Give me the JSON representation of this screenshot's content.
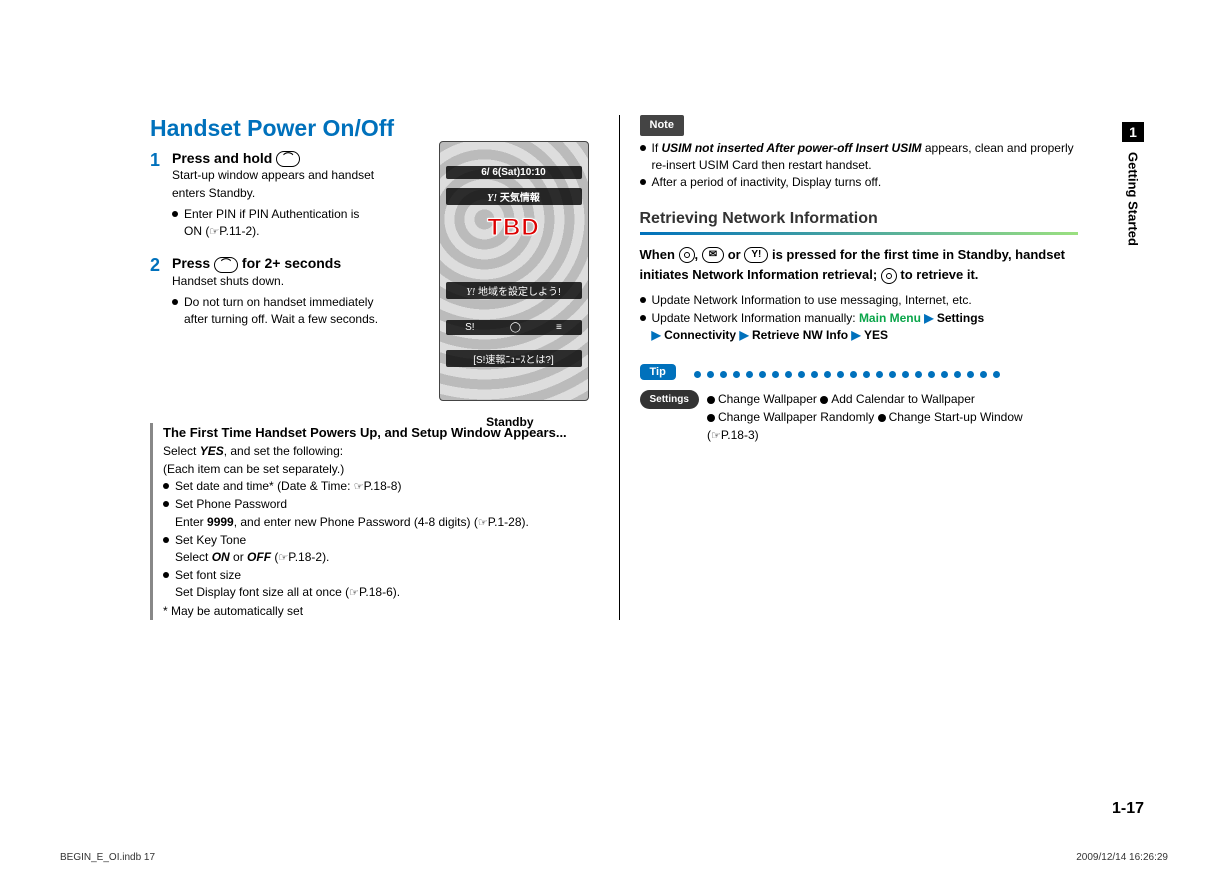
{
  "chapter_tab": {
    "num": "1",
    "label": "Getting Started"
  },
  "title": "Handset Power On/Off",
  "steps": {
    "s1": {
      "num": "1",
      "head_prefix": "Press and hold ",
      "key_glyph": "⏻",
      "body": "Start-up window appears and handset enters Standby.",
      "bullet": "Enter PIN if PIN Authentication is ON (",
      "ref": "P.11-2",
      "bullet_suffix": ")."
    },
    "s2": {
      "num": "2",
      "head_prefix": "Press ",
      "key_glyph": "⏻",
      "head_suffix": " for 2+ seconds",
      "body": "Handset shuts down.",
      "bullet": "Do not turn on handset immediately after turning off. Wait a few seconds."
    }
  },
  "screenshot": {
    "time": "6/  6(Sat)10:10",
    "weather": "天気情報",
    "tbd": "TBD",
    "region": "地域を設定しよう!",
    "news": "[S!速報ﾆｭｰｽとは?]",
    "caption": "Standby"
  },
  "first_time": {
    "head": "The First Time Handset Powers Up, and Setup Window Appears...",
    "select_prefix": "Select ",
    "yes": "YES",
    "select_suffix": ", and set the following:",
    "each": "(Each item can be set separately.)",
    "items": {
      "i1": {
        "text": "Set date and time* (Date & Time: ",
        "ref": "P.18-8",
        "suffix": ")"
      },
      "i2": {
        "text": "Set Phone Password",
        "sub_prefix": "Enter ",
        "code": "9999",
        "sub_mid": ", and enter new Phone Password (4-8 digits) (",
        "ref": "P.1-28",
        "sub_suffix": ")."
      },
      "i3": {
        "text": "Set Key Tone",
        "sub_prefix": "Select ",
        "on": "ON",
        "or": " or ",
        "off": "OFF",
        "sub_paren": " (",
        "ref": "P.18-2",
        "sub_suffix": ")."
      },
      "i4": {
        "text": "Set font size",
        "sub": "Set Display font size all at once (",
        "ref": "P.18-6",
        "sub_suffix": ")."
      }
    },
    "footnote": "* May be automatically set"
  },
  "note": {
    "label": "Note",
    "b1_prefix": "If ",
    "b1_ital": "USIM not inserted After power-off Insert USIM",
    "b1_suffix": " appears, clean and properly re-insert USIM Card then restart handset.",
    "b2": "After a period of inactivity, Display turns off."
  },
  "retrieve": {
    "heading": "Retrieving Network Information",
    "lead_prefix": "When ",
    "lead_mid1": ", ",
    "lead_mid2": " or ",
    "lead_mid3": " is pressed for the first time in Standby, handset initiates Network Information retrieval; ",
    "lead_suffix": " to retrieve it.",
    "b1": "Update Network Information to use messaging, Internet, etc.",
    "b2_prefix": "Update Network Information manually: ",
    "menu": "Main Menu",
    "path1": "Settings",
    "path2": "Connectivity",
    "path3": "Retrieve NW Info",
    "path4": "YES"
  },
  "tip": {
    "label": "Tip",
    "settings_label": "Settings",
    "items": {
      "t1": "Change Wallpaper ",
      "t2": "Add Calendar to Wallpaper",
      "t3": "Change Wallpaper Randomly ",
      "t4": "Change Start-up Window"
    },
    "ref_prefix": "(",
    "ref": "P.18-3",
    "ref_suffix": ")"
  },
  "page_num": "1-17",
  "footer": {
    "left": "BEGIN_E_OI.indb   17",
    "right": "2009/12/14   16:26:29"
  }
}
